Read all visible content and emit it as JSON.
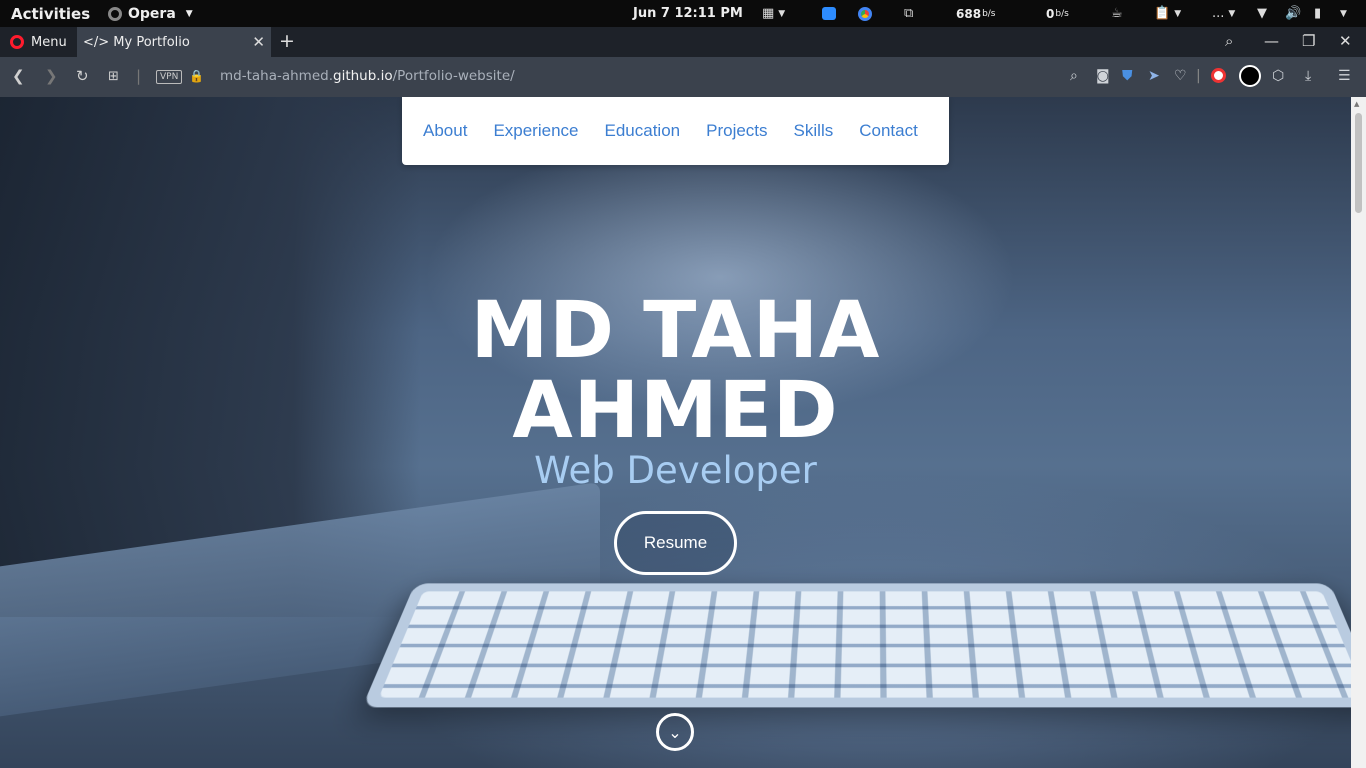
{
  "system": {
    "activities": "Activities",
    "app_name": "Opera",
    "clock": "Jun 7  12:11 PM",
    "net_down": "688",
    "net_down_unit": "b/s",
    "net_up": "0",
    "net_up_unit": "b/s",
    "overflow": "..."
  },
  "browser": {
    "menu_label": "Menu",
    "tab_title": "</> My Portfolio",
    "vpn_label": "VPN",
    "url_prefix": "md-taha-ahmed.",
    "url_domain": "github.io",
    "url_path": "/Portfolio-website/"
  },
  "site": {
    "nav": [
      "About",
      "Experience",
      "Education",
      "Projects",
      "Skills",
      "Contact"
    ],
    "name_line1": "MD TAHA",
    "name_line2": "AHMED",
    "role": "Web Developer",
    "resume_label": "Resume"
  },
  "colors": {
    "nav_link": "#3c7ed1",
    "role_text": "#a8cdf2",
    "opera_red": "#ff1b2d"
  }
}
